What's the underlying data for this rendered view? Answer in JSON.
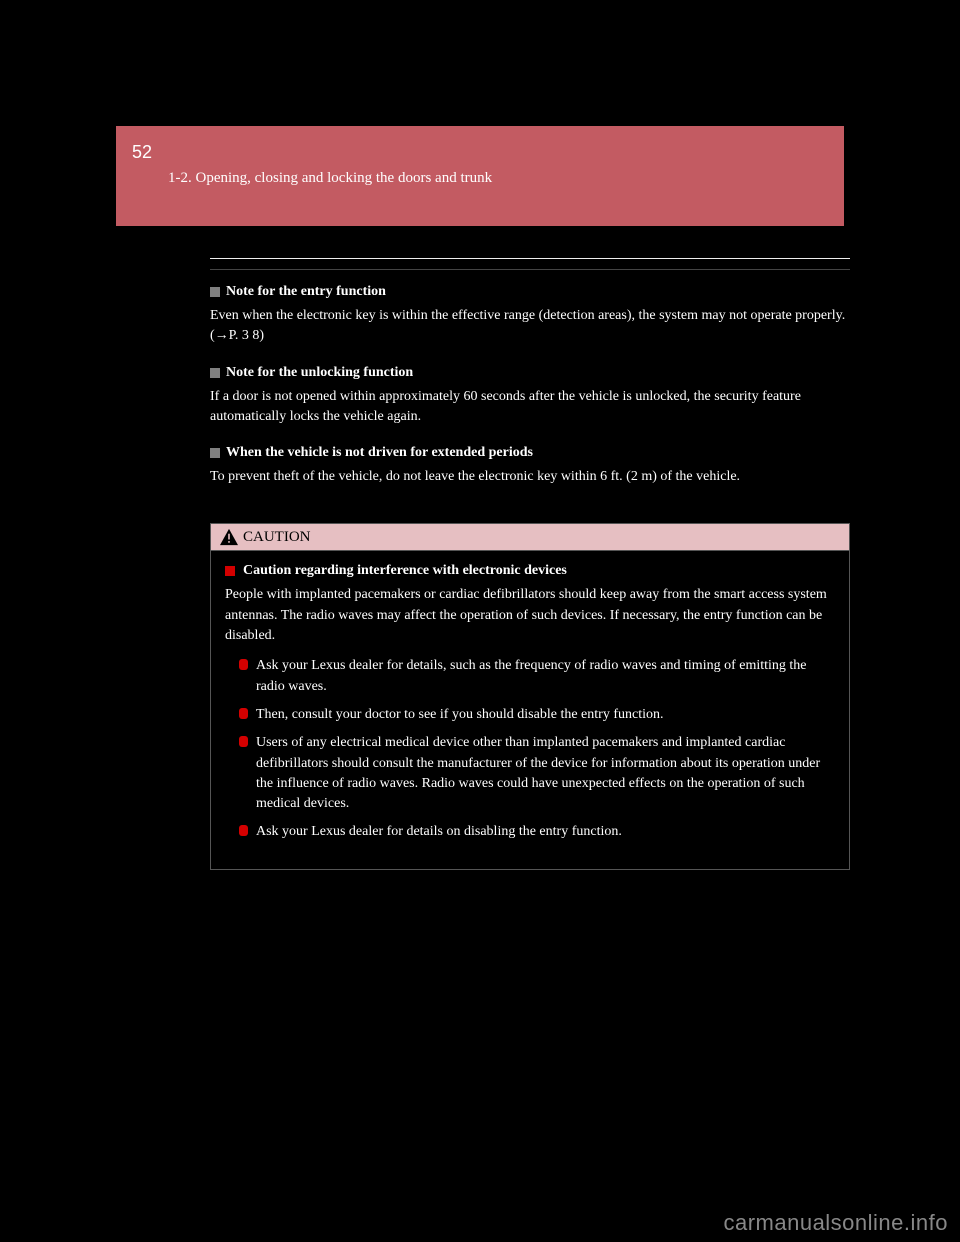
{
  "page_number": "52",
  "section": "1-2. Opening, closing and locking the doors and trunk",
  "notes": [
    {
      "title": "Note for the entry function",
      "body_before": "Even when the electronic key is within the effective range (detection areas), the system may not operate properly. (",
      "link": "→P. 3 8",
      "body_after": ")"
    },
    {
      "title": "Note for the unlocking function",
      "body": "If a door is not opened within approximately 60 seconds after the vehicle is unlocked, the security feature automatically locks the vehicle again."
    },
    {
      "title": "When the vehicle is not driven for extended periods",
      "body": "To prevent theft of the vehicle, do not leave the electronic key within 6 ft. (2 m) of the vehicle."
    }
  ],
  "caution": {
    "header": "CAUTION",
    "title": "Caution regarding interference with electronic devices",
    "lead": "People with implanted pacemakers or cardiac defibrillators should keep away from the smart access system antennas. The radio waves may affect the operation of such devices. If necessary, the entry function can be disabled.",
    "items": [
      "Ask your Lexus dealer for details, such as the frequency of radio waves and timing of emitting the radio waves.",
      "Then, consult your doctor to see if you should disable the entry function.",
      "Users of any electrical medical device other than implanted pacemakers and implanted cardiac defibrillators should consult the manufacturer of the device for information about its operation under the influence of radio waves. Radio waves could have unexpected effects on the operation of such medical devices.",
      "Ask your Lexus dealer for details on disabling the entry function."
    ]
  },
  "watermark": "carmanualsonline.info"
}
